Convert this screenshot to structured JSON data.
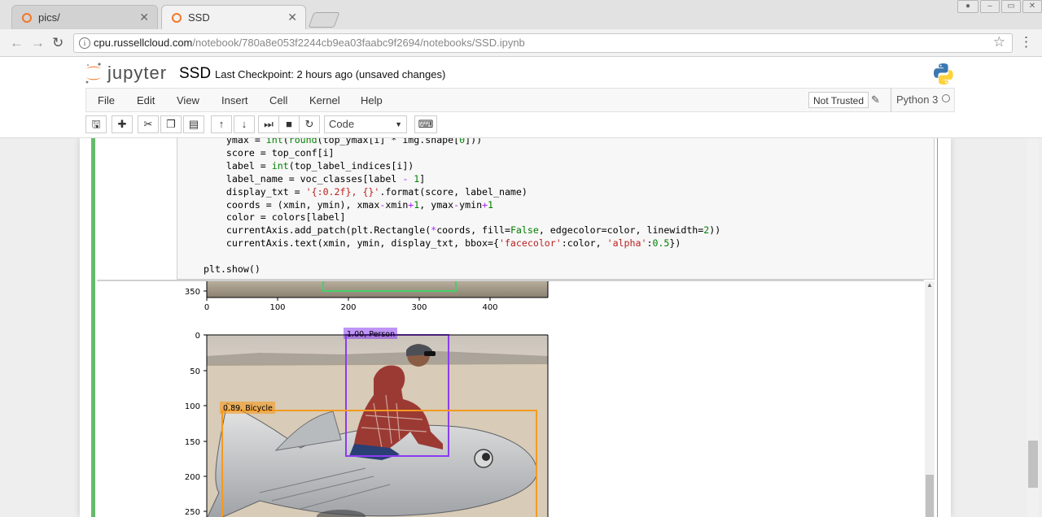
{
  "browser": {
    "tabs": [
      {
        "title": "pics/"
      },
      {
        "title": "SSD"
      }
    ],
    "url_host": "cpu.russellcloud.com",
    "url_path": "/notebook/780a8e053f2244cb9ea03faabc9f2694/notebooks/SSD.ipynb"
  },
  "jupyter": {
    "logo_text": "jupyter",
    "notebook_name": "SSD",
    "checkpoint": "Last Checkpoint: 2 hours ago (unsaved changes)",
    "menu": [
      "File",
      "Edit",
      "View",
      "Insert",
      "Cell",
      "Kernel",
      "Help"
    ],
    "trust": "Not Trusted",
    "kernel": "Python 3",
    "cell_type": "Code"
  },
  "code_lines": [
    "ymax = int(round(top_ymax[i] * img.shape[0]))",
    "score = top_conf[i]",
    "label = int(top_label_indices[i])",
    "label_name = voc_classes[label - 1]",
    "display_txt = '{:0.2f}, {}'.format(score, label_name)",
    "coords = (xmin, ymin), xmax-xmin+1, ymax-ymin+1",
    "color = colors[label]",
    "currentAxis.add_patch(plt.Rectangle(*coords, fill=False, edgecolor=color, linewidth=2))",
    "currentAxis.text(xmin, ymin, display_txt, bbox={'facecolor':color, 'alpha':0.5})",
    "",
    "plt.show()"
  ],
  "plot_top": {
    "y_ticks": [
      "350"
    ],
    "x_ticks": [
      "0",
      "100",
      "200",
      "300",
      "400"
    ]
  },
  "plot_main": {
    "y_ticks": [
      "0",
      "50",
      "100",
      "150",
      "200",
      "250"
    ],
    "detections": [
      {
        "label": "1.00, Person",
        "color": "#8a3cf0"
      },
      {
        "label": "0.89, Bicycle",
        "color": "#f59a1e"
      }
    ]
  }
}
